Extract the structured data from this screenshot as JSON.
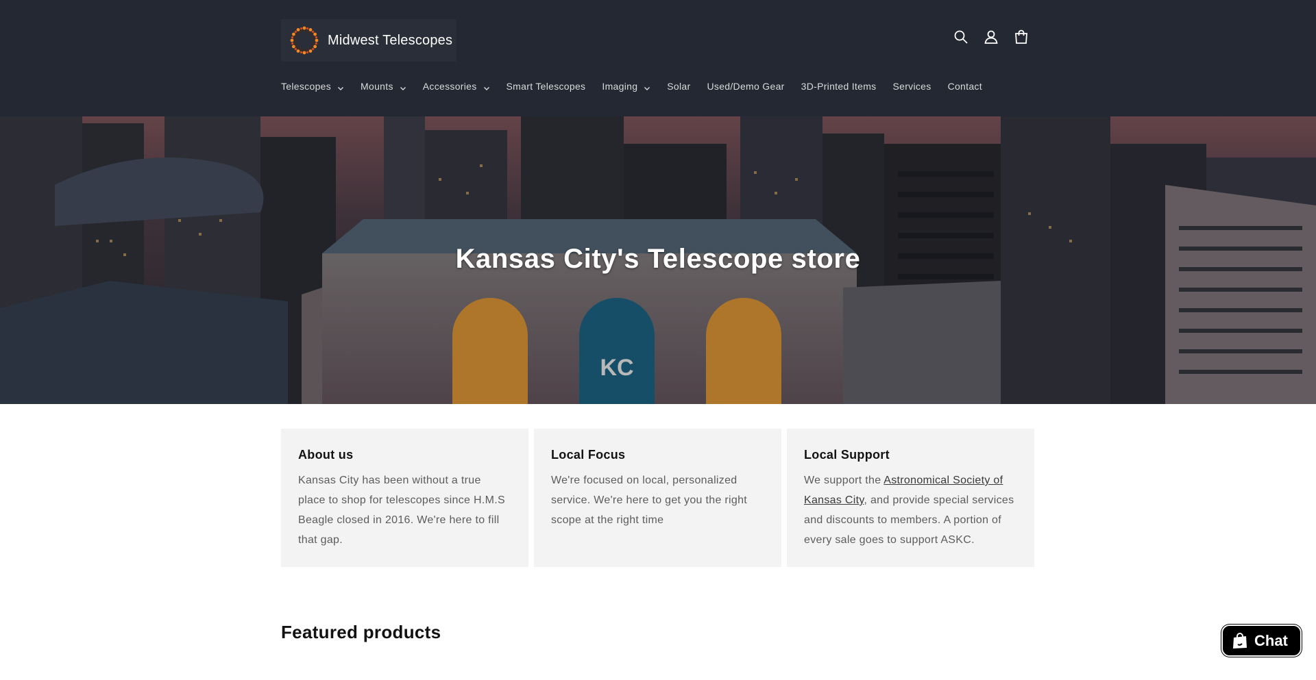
{
  "header": {
    "logo_text": "Midwest Telescopes",
    "icons": [
      "search-icon",
      "account-icon",
      "cart-icon"
    ],
    "nav": [
      {
        "label": "Telescopes",
        "dropdown": true
      },
      {
        "label": "Mounts",
        "dropdown": true
      },
      {
        "label": "Accessories",
        "dropdown": true
      },
      {
        "label": "Smart Telescopes",
        "dropdown": false
      },
      {
        "label": "Imaging",
        "dropdown": true
      },
      {
        "label": "Solar",
        "dropdown": false
      },
      {
        "label": "Used/Demo Gear",
        "dropdown": false
      },
      {
        "label": "3D-Printed Items",
        "dropdown": false
      },
      {
        "label": "Services",
        "dropdown": false
      },
      {
        "label": "Contact",
        "dropdown": false
      }
    ]
  },
  "hero": {
    "title": "Kansas City's Telescope store"
  },
  "cards": [
    {
      "title": "About us",
      "text": "Kansas City has been without a true place to shop for telescopes since H.M.S Beagle closed in 2016. We're here to fill that gap."
    },
    {
      "title": "Local Focus",
      "text": "We're focused on local, personalized service. We're here to get you the right scope at the right time"
    },
    {
      "title": "Local Support",
      "text_before": "We support the ",
      "link": "Astronomical Society of Kansas City",
      "text_after": ", and provide special services and discounts to members. A portion of every sale goes to support ASKC."
    }
  ],
  "featured_title": "Featured products",
  "chat_label": "Chat",
  "colors": {
    "header_bg": "#242833",
    "card_bg": "#f3f3f3",
    "chat_bg": "#000000"
  }
}
